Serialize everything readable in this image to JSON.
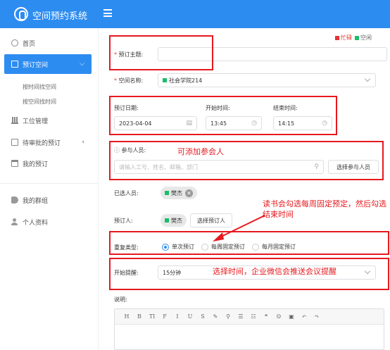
{
  "header": {
    "title": "空间预约系统"
  },
  "sidebar": {
    "items": [
      {
        "label": "首页"
      },
      {
        "label": "预订空间"
      },
      {
        "label": "工位管理"
      },
      {
        "label": "待审批的预订"
      },
      {
        "label": "我的预订"
      },
      {
        "label": "我的群组"
      },
      {
        "label": "个人资料"
      }
    ],
    "sub_items": [
      {
        "label": "按时间找空间"
      },
      {
        "label": "按空间找时间"
      }
    ]
  },
  "legend": {
    "busy": "忙碌",
    "free": "空闲",
    "busy_color": "#e33333",
    "free_color": "#19be6b"
  },
  "form": {
    "subject_label": "预订主题:",
    "space_label": "空间名称:",
    "space_value": "社会学院214",
    "date_label": "预订日期:",
    "date_value": "2023-04-04",
    "start_label": "开始时间:",
    "start_value": "13:45",
    "end_label": "结束时间:",
    "end_value": "14:15",
    "participants_label": "参与人员:",
    "participants_placeholder": "请输入工号、姓名、邮箱、部门",
    "choose_participants_button": "选择参与人员",
    "selected_label": "已选人员:",
    "selected_person": "樊杰",
    "booker_label": "预订人:",
    "booker_name": "樊杰",
    "choose_booker_button": "选择预订人",
    "repeat_label": "重复类型:",
    "repeat_options": [
      {
        "label": "单次预订",
        "selected": true
      },
      {
        "label": "每周固定预订",
        "selected": false
      },
      {
        "label": "每月固定预订",
        "selected": false
      }
    ],
    "reminder_label": "开始提醒:",
    "reminder_value": "15分钟",
    "description_label": "说明:"
  },
  "editor_toolbar": [
    "H",
    "B",
    "TI",
    "F",
    "I",
    "U",
    "S",
    "✎",
    "⚲",
    "☰",
    "☷",
    "❝",
    "☺",
    "▣",
    "↶",
    "↷"
  ],
  "annotations": {
    "participants": "可添加参会人",
    "repeat": "读书会勾选每周固定预定，然后勾选结束时间",
    "reminder": "选择时间，企业微信会推送会议提醒"
  }
}
